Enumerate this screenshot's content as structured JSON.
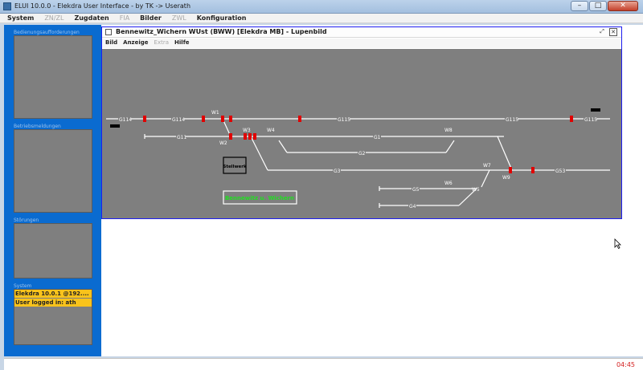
{
  "window": {
    "title": "ELUI 10.0.0 - Elekdra User Interface - by TK  ->  Userath",
    "minimize": "–",
    "maximize": "□",
    "close": "✕"
  },
  "menu": [
    "System",
    "ZN/ZL",
    "Zugdaten",
    "FIA",
    "Bilder",
    "ZWL",
    "Konfiguration"
  ],
  "menu_disabled": [
    false,
    true,
    false,
    true,
    false,
    true,
    false
  ],
  "sidebar": {
    "panels": [
      {
        "label": "Bedienungsaufforderungen"
      },
      {
        "label": "Betriebsmeldungen"
      },
      {
        "label": "Störungen"
      },
      {
        "label": "System"
      }
    ],
    "system_lines": [
      "Elekdra 10.0.1 @192....",
      "User logged in: ath"
    ]
  },
  "inner_window": {
    "title": "Bennewitz_Wichern WUst (BWW) [Elekdra MB]  -  Lupenbild",
    "restore": "⤢",
    "close": "✕",
    "menu": [
      "Bild",
      "Anzeige",
      "Extra",
      "Hilfe"
    ],
    "menu_disabled": [
      false,
      false,
      true,
      false
    ]
  },
  "schematic": {
    "track_labels": {
      "g114_a": "G114",
      "g114_b": "G114",
      "g115_a": "G115",
      "g115_b": "G115",
      "g115_c": "G115",
      "g11": "G11",
      "g1": "G1",
      "g2": "G2",
      "g3": "G3",
      "g53": "G53",
      "g5": "G5",
      "g4": "G4"
    },
    "switch_labels": {
      "w1": "W1",
      "w2": "W2",
      "w3": "W3",
      "w4": "W4",
      "w5": "W5",
      "w6": "W6",
      "w7": "W7",
      "w8": "W8",
      "w9": "W9"
    },
    "stellwerk": "Stellwerk",
    "station_name": "Bennewitz u. Wichern",
    "colors": {
      "track": "#ffffff",
      "signal": "#e00000",
      "station_name": "#22dd22"
    }
  },
  "status": {
    "clock": "04:45"
  }
}
